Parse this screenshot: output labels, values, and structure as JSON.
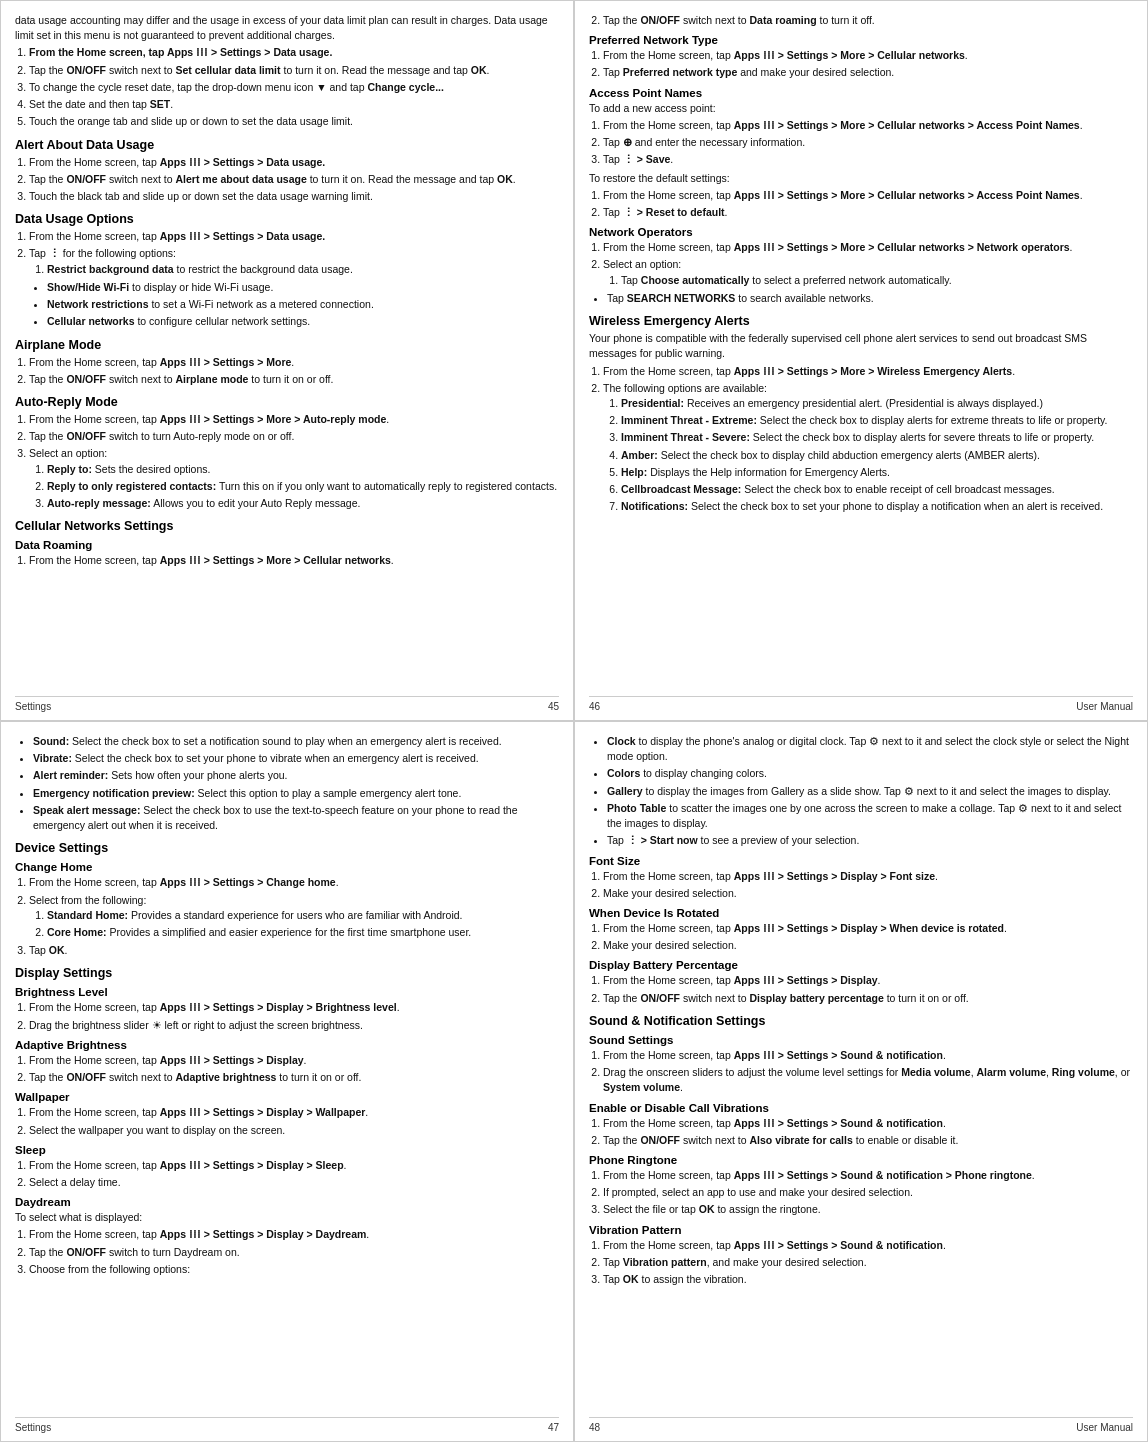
{
  "panels": {
    "p1": {
      "footer_left": "Settings",
      "footer_right": "45",
      "content": {
        "intro": "data usage accounting may differ and the usage in excess of your data limit plan can result in charges. Data usage limit set in this menu is not guaranteed to prevent additional charges.",
        "section1_heading": "Alert About Data Usage",
        "section2_heading": "Data Usage Options",
        "bullet_items": [
          "Show/Hide Wi-Fi to display or hide Wi-Fi usage.",
          "Network restrictions to set a Wi-Fi network as a metered connection.",
          "Cellular networks to configure cellular network settings."
        ],
        "airplane_heading": "Airplane Mode",
        "autoreply_heading": "Auto-Reply Mode",
        "cellular_heading": "Cellular Networks Settings",
        "data_roaming_heading": "Data Roaming"
      }
    },
    "p2": {
      "footer_left": "46",
      "footer_right": "User Manual",
      "content": {
        "pnt_heading": "Preferred Network Type",
        "apn_heading": "Access Point Names",
        "net_op_heading": "Network Operators",
        "wireless_heading": "Wireless Emergency Alerts",
        "wireless_desc": "Your phone is compatible with the federally supervised cell phone alert services to send out broadcast SMS messages for public warning."
      }
    },
    "p3": {
      "footer_left": "Settings",
      "footer_right": "47",
      "content": {
        "device_heading": "Device Settings",
        "change_home_heading": "Change Home",
        "display_heading": "Display Settings",
        "brightness_heading": "Brightness Level",
        "adaptive_heading": "Adaptive Brightness",
        "wallpaper_heading": "Wallpaper",
        "sleep_heading": "Sleep",
        "daydream_heading": "Daydream"
      }
    },
    "p4": {
      "footer_left": "48",
      "footer_right": "User Manual",
      "content": {
        "sound_heading": "Sound & Notification Settings",
        "sound_settings_heading": "Sound Settings",
        "enable_vibration_heading": "Enable or Disable Call Vibrations",
        "phone_ringtone_heading": "Phone Ringtone",
        "vibration_pattern_heading": "Vibration Pattern",
        "font_size_heading": "Font Size",
        "rotated_heading": "When Device Is Rotated",
        "battery_heading": "Display Battery Percentage"
      }
    }
  }
}
